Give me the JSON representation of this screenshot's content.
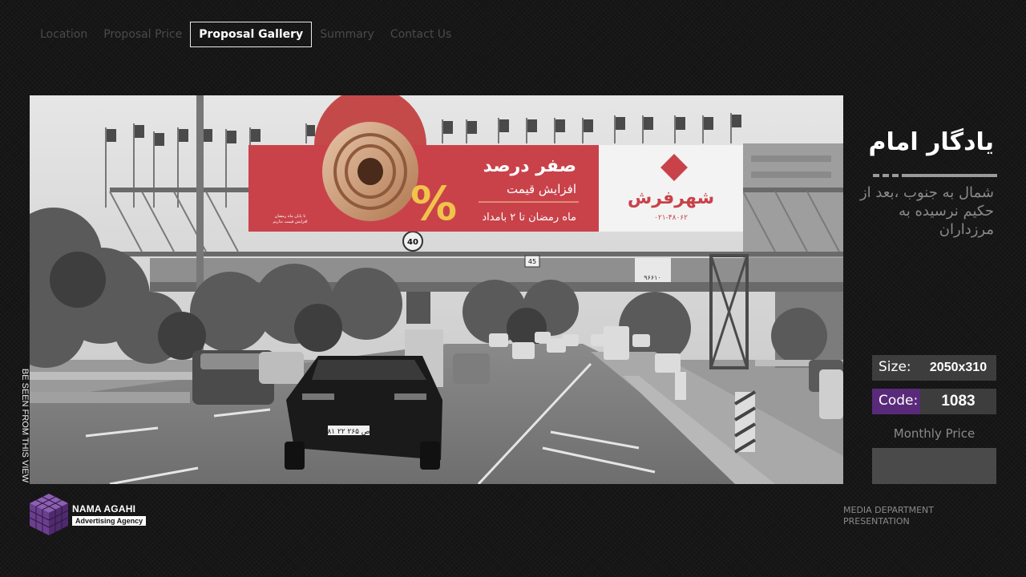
{
  "nav": {
    "items": [
      {
        "label": "Location",
        "active": false
      },
      {
        "label": "Proposal Price",
        "active": false
      },
      {
        "label": "Proposal Gallery",
        "active": true
      },
      {
        "label": "Summary",
        "active": false
      },
      {
        "label": "Contact Us",
        "active": false
      }
    ]
  },
  "photo": {
    "side_caption": "BE SEEN FROM THIS VIEW",
    "billboard": {
      "headline": "صفر درصد",
      "subline": "افزایش قیمت",
      "offer": "ماه رمضان تا ۲ بامداد",
      "brand": "شهرفرش",
      "phone": "۰۲۱-۴۸۰۶۲",
      "percent_sign": "%",
      "small_text_1": "تا پایان ماه رمضان",
      "small_text_2": "افزایش قیمت نداریم"
    },
    "plates": [
      "۸۱ ص ۲۶۵ ۲۲"
    ],
    "sign_speed": "40",
    "sign_bridge": "45",
    "sign_phone": "۹۶۶۱۰"
  },
  "location": {
    "title": "یادگار امام",
    "description": "شمال به جنوب ،بعد از حکیم نرسیده به مرزداران"
  },
  "info": {
    "size_label": "Size:",
    "size_value": "2050x310",
    "code_label": "Code:",
    "code_value": "1083",
    "code_color": "#5a2a7a",
    "monthly_price_label": "Monthly Price"
  },
  "footer": {
    "brand_name": "NAMA AGAHI",
    "brand_tagline": "Advertising Agency",
    "logo_color": "#6b3f8f",
    "dept_line1": "MEDIA DEPARTMENT",
    "dept_line2": "PRESENTATION"
  }
}
